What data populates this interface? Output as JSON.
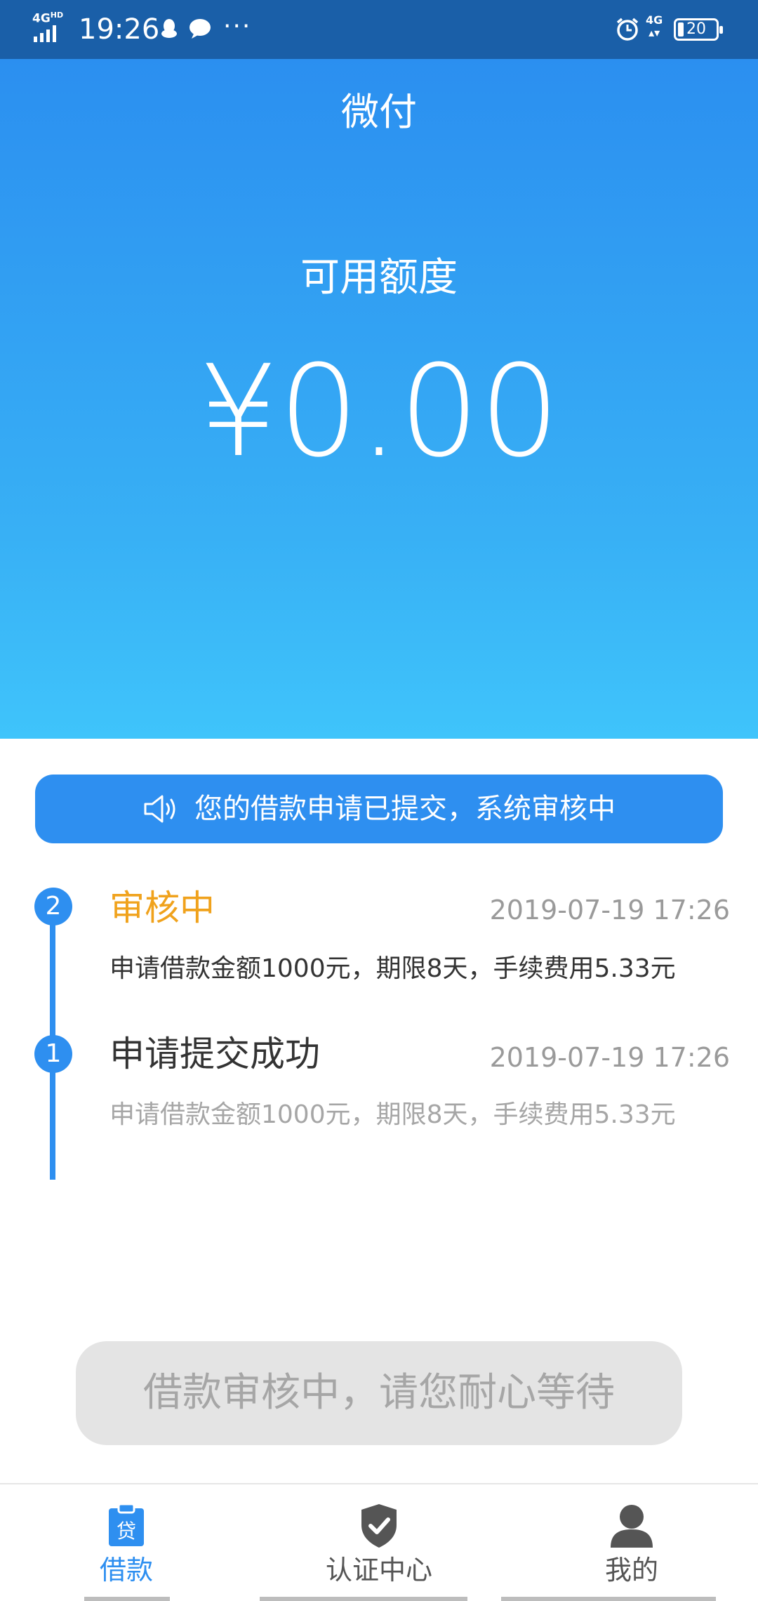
{
  "status_bar": {
    "network": "4G",
    "network_hd": "HD",
    "time": "19:26",
    "more": "···",
    "net_type": "4G",
    "battery": "20"
  },
  "header": {
    "title": "微付"
  },
  "hero": {
    "limit_label": "可用额度",
    "amount": "¥0.00"
  },
  "notice": {
    "icon": "speaker-icon",
    "text": "您的借款申请已提交，系统审核中"
  },
  "timeline": {
    "steps": [
      {
        "number": "2",
        "title": "审核中",
        "time": "2019-07-19 17:26",
        "description": "申请借款金额1000元，期限8天，手续费用5.33元",
        "title_color": "#f0a21c",
        "desc_color": "#333333"
      },
      {
        "number": "1",
        "title": "申请提交成功",
        "time": "2019-07-19 17:26",
        "description": "申请借款金额1000元，期限8天，手续费用5.33元",
        "title_color": "#333333",
        "desc_color": "#a6a6a6"
      }
    ]
  },
  "wait_button": {
    "label": "借款审核中，请您耐心等待"
  },
  "tabbar": {
    "items": [
      {
        "label": "借款",
        "icon": "loan-icon",
        "active": true
      },
      {
        "label": "认证中心",
        "icon": "shield-check-icon",
        "active": false
      },
      {
        "label": "我的",
        "icon": "person-icon",
        "active": false
      }
    ],
    "active_color": "#2e8ff0",
    "inactive_color": "#555555"
  },
  "colors": {
    "primary": "#2e8ff0",
    "status_bar": "#1a5fa8",
    "pending": "#f0a21c"
  }
}
